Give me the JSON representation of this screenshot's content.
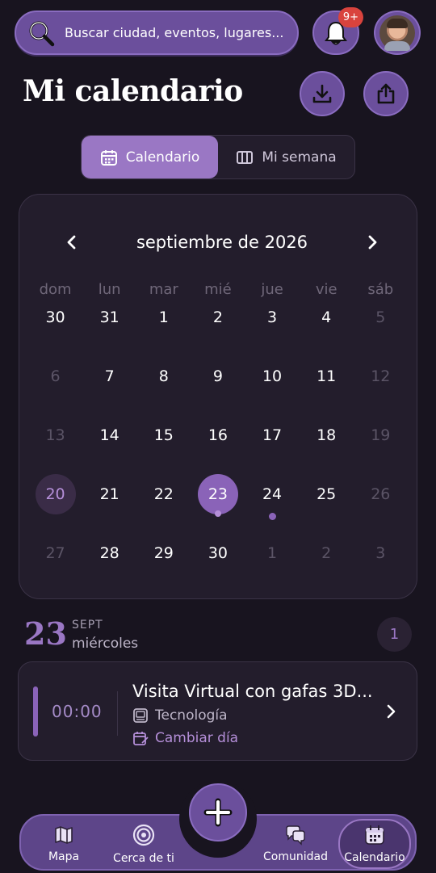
{
  "search": {
    "placeholder": "Buscar ciudad, eventos, lugares..."
  },
  "notifications": {
    "badge": "9+"
  },
  "header": {
    "title": "Mi calendario"
  },
  "view_toggle": [
    {
      "label": "Calendario",
      "active": true
    },
    {
      "label": "Mi semana",
      "active": false
    }
  ],
  "calendar": {
    "month_label": "septiembre de 2026",
    "weekdays": [
      "dom",
      "lun",
      "mar",
      "mié",
      "jue",
      "vie",
      "sáb"
    ],
    "days": [
      {
        "n": "30",
        "state": "normal"
      },
      {
        "n": "31",
        "state": "normal"
      },
      {
        "n": "1",
        "state": "normal"
      },
      {
        "n": "2",
        "state": "normal"
      },
      {
        "n": "3",
        "state": "normal"
      },
      {
        "n": "4",
        "state": "normal"
      },
      {
        "n": "5",
        "state": "muted"
      },
      {
        "n": "6",
        "state": "muted"
      },
      {
        "n": "7",
        "state": "normal"
      },
      {
        "n": "8",
        "state": "normal"
      },
      {
        "n": "9",
        "state": "normal"
      },
      {
        "n": "10",
        "state": "normal"
      },
      {
        "n": "11",
        "state": "normal"
      },
      {
        "n": "12",
        "state": "muted"
      },
      {
        "n": "13",
        "state": "muted"
      },
      {
        "n": "14",
        "state": "normal"
      },
      {
        "n": "15",
        "state": "normal"
      },
      {
        "n": "16",
        "state": "normal"
      },
      {
        "n": "17",
        "state": "normal"
      },
      {
        "n": "18",
        "state": "normal"
      },
      {
        "n": "19",
        "state": "muted"
      },
      {
        "n": "20",
        "state": "today"
      },
      {
        "n": "21",
        "state": "normal"
      },
      {
        "n": "22",
        "state": "normal"
      },
      {
        "n": "23",
        "state": "selected",
        "dot": true
      },
      {
        "n": "24",
        "state": "normal",
        "dot": true
      },
      {
        "n": "25",
        "state": "normal"
      },
      {
        "n": "26",
        "state": "muted"
      },
      {
        "n": "27",
        "state": "muted"
      },
      {
        "n": "28",
        "state": "normal"
      },
      {
        "n": "29",
        "state": "normal"
      },
      {
        "n": "30",
        "state": "normal"
      },
      {
        "n": "1",
        "state": "muted"
      },
      {
        "n": "2",
        "state": "muted"
      },
      {
        "n": "3",
        "state": "muted"
      }
    ]
  },
  "selected_date": {
    "day": "23",
    "month": "SEPT",
    "weekday": "miércoles",
    "event_count": "1"
  },
  "events": [
    {
      "time": "00:00",
      "title": "Visita Virtual con gafas 3D...",
      "category": "Tecnología",
      "change_label": "Cambiar día"
    }
  ],
  "bottom_nav": [
    {
      "label": "Mapa",
      "icon": "map-icon"
    },
    {
      "label": "Cerca de ti",
      "icon": "nearby-icon"
    },
    {
      "label": "Comunidad",
      "icon": "chat-icon"
    },
    {
      "label": "Calendario",
      "icon": "calendar-icon",
      "active": true
    }
  ],
  "colors": {
    "accent": "#8a63b8",
    "background": "#18141f",
    "card": "#231d2c",
    "badge": "#d9433d"
  }
}
